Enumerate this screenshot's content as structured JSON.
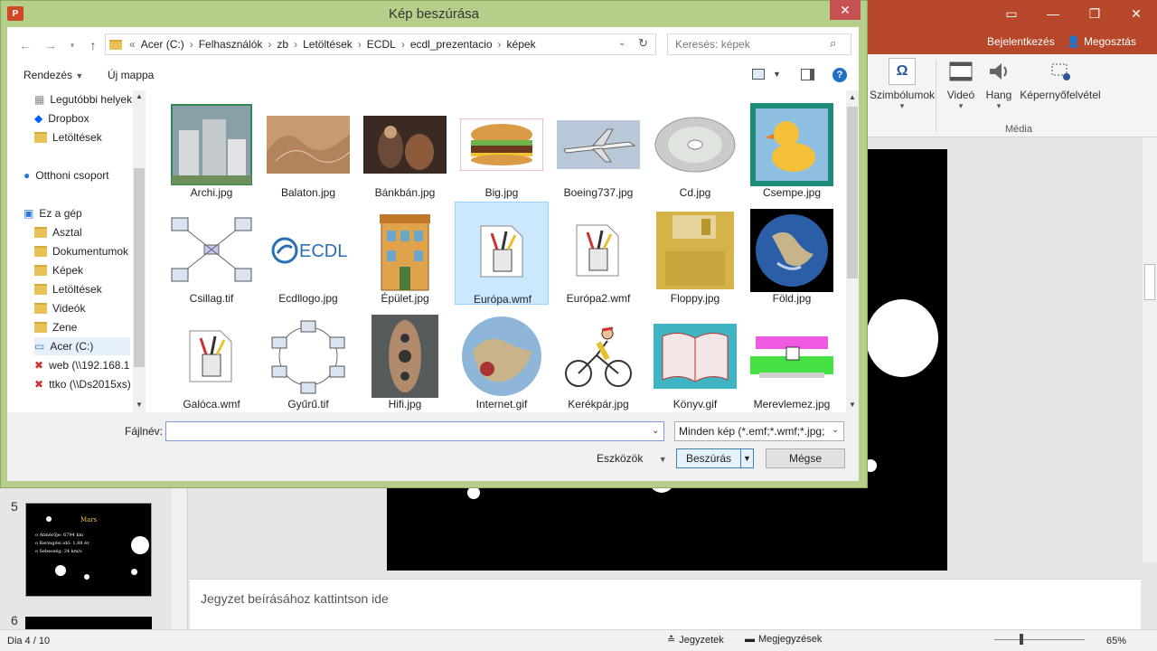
{
  "ppt": {
    "login": "Bejelentkezés",
    "share": "Megosztás",
    "ribbon": {
      "symbols": "Szimbólumok",
      "video": "Videó",
      "audio": "Hang",
      "screen_recording": "Képernyőfelvétel",
      "media_group": "Média"
    },
    "slide5_num": "5",
    "slide6_num": "6",
    "slide5": {
      "title": "Mars",
      "line1": "o Átmérője: 6794 km",
      "line2": "o Keringési idő: 1,88 év",
      "line3": "o Sebesség: 24 km/s"
    },
    "notes_placeholder": "Jegyzet beírásához kattintson ide",
    "status": {
      "slide": "Dia 4 / 10",
      "notes": "Jegyzetek",
      "comments": "Megjegyzések",
      "zoom": "65%"
    }
  },
  "dialog": {
    "title": "Kép beszúrása",
    "app_icon": "P",
    "breadcrumb": [
      "Acer (C:)",
      "Felhasználók",
      "zb",
      "Letöltések",
      "ECDL",
      "ecdl_prezentacio",
      "képek"
    ],
    "breadcrumb_prefix": "«",
    "search_placeholder": "Keresés: képek",
    "organize": "Rendezés",
    "new_folder": "Új mappa",
    "nav_items": [
      {
        "label": "Legutóbbi helyek",
        "icon": "recent-places-icon"
      },
      {
        "label": "Dropbox",
        "icon": "dropbox-icon"
      },
      {
        "label": "Letöltések",
        "icon": "folder-icon"
      },
      {
        "label": "Otthoni csoport",
        "icon": "homegroup-icon"
      },
      {
        "label": "Ez a gép",
        "icon": "computer-icon"
      },
      {
        "label": "Asztal",
        "icon": "folder-icon"
      },
      {
        "label": "Dokumentumok",
        "icon": "folder-icon"
      },
      {
        "label": "Képek",
        "icon": "folder-icon"
      },
      {
        "label": "Letöltések",
        "icon": "folder-icon"
      },
      {
        "label": "Videók",
        "icon": "folder-icon"
      },
      {
        "label": "Zene",
        "icon": "folder-icon"
      },
      {
        "label": "Acer (C:)",
        "icon": "drive-icon"
      },
      {
        "label": "web (\\\\192.168.1",
        "icon": "network-drive-icon"
      },
      {
        "label": "ttko (\\\\Ds2015xs)",
        "icon": "network-drive-icon"
      }
    ],
    "files": [
      {
        "name": "Archi.jpg",
        "thumb": "building-photo"
      },
      {
        "name": "Balaton.jpg",
        "thumb": "relief-map"
      },
      {
        "name": "Bánkbán.jpg",
        "thumb": "painting"
      },
      {
        "name": "Big.jpg",
        "thumb": "burger"
      },
      {
        "name": "Boeing737.jpg",
        "thumb": "airplane"
      },
      {
        "name": "Cd.jpg",
        "thumb": "cd"
      },
      {
        "name": "Csempe.jpg",
        "thumb": "duck-tile"
      },
      {
        "name": "Csillag.tif",
        "thumb": "star-network"
      },
      {
        "name": "Ecdllogo.jpg",
        "thumb": "ecdl-logo"
      },
      {
        "name": "Épület.jpg",
        "thumb": "house"
      },
      {
        "name": "Európa.wmf",
        "thumb": "wmf-pencils"
      },
      {
        "name": "Európa2.wmf",
        "thumb": "wmf-pencils"
      },
      {
        "name": "Floppy.jpg",
        "thumb": "floppy"
      },
      {
        "name": "Föld.jpg",
        "thumb": "earth"
      },
      {
        "name": "Galóca.wmf",
        "thumb": "wmf-pencils"
      },
      {
        "name": "Gyűrű.tif",
        "thumb": "ring-network"
      },
      {
        "name": "Hifi.jpg",
        "thumb": "speaker"
      },
      {
        "name": "Internet.gif",
        "thumb": "globe"
      },
      {
        "name": "Kerékpár.jpg",
        "thumb": "cyclist"
      },
      {
        "name": "Könyv.gif",
        "thumb": "book"
      },
      {
        "name": "Merevlemez.jpg",
        "thumb": "hard-disk"
      }
    ],
    "selected_file": "Európa.wmf",
    "filename_label": "Fájlnév:",
    "filename_value": "",
    "filetype": "Minden kép (*.emf;*.wmf;*.jpg;",
    "tools": "Eszközök",
    "insert": "Beszúrás",
    "cancel": "Mégse"
  }
}
